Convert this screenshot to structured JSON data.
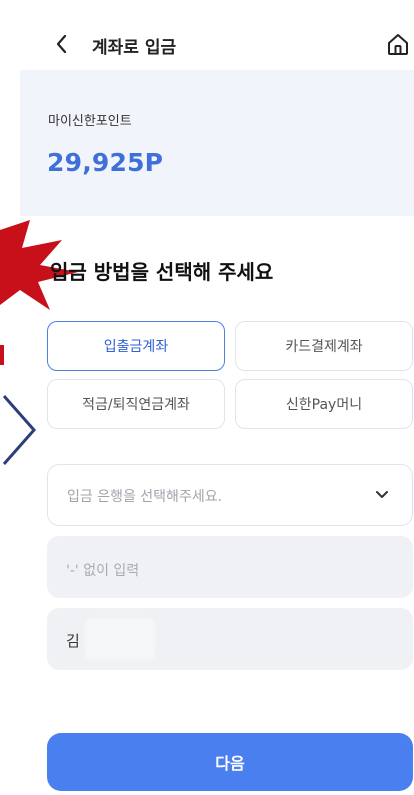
{
  "header": {
    "title": "계좌로 입금"
  },
  "points": {
    "label": "마이신한포인트",
    "value": "29,925P"
  },
  "section": {
    "title": "입금 방법을 선택해 주세요"
  },
  "methods": [
    {
      "label": "입출금계좌",
      "selected": true
    },
    {
      "label": "카드결제계좌",
      "selected": false
    },
    {
      "label": "적금/퇴직연금계좌",
      "selected": false
    },
    {
      "label": "신한Pay머니",
      "selected": false
    }
  ],
  "form": {
    "bank_placeholder": "입금 은행을 선택해주세요.",
    "account_placeholder": "'-' 없이 입력",
    "name_value": "김"
  },
  "footer": {
    "next_label": "다음"
  },
  "colors": {
    "accent": "#4a7ff0",
    "points_blue": "#3f6fd8",
    "card_bg": "#f1f4fa"
  }
}
